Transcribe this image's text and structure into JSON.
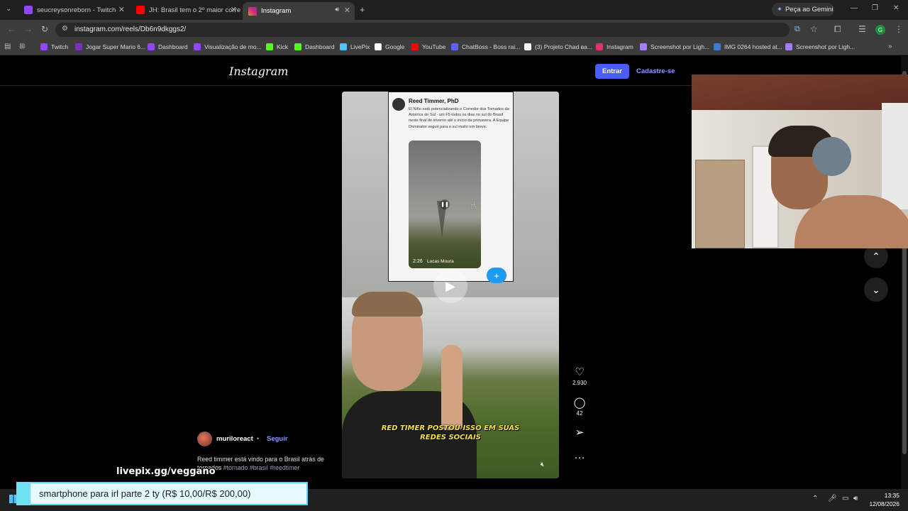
{
  "browser": {
    "tabs": [
      {
        "title": "seucreysonreborn - Twitch",
        "icon": "twitch-icon",
        "color": "#9146ff"
      },
      {
        "title": "JH: Brasil tem o 2º maior corre",
        "icon": "youtube-icon",
        "color": "#ff0000"
      },
      {
        "title": "Instagram",
        "icon": "instagram-icon",
        "color": "#e1306c",
        "active": true
      }
    ],
    "new_tab": "+",
    "gemini_label": "Peça ao Gemini",
    "url": "instagram.com/reels/Db6n9dkggs2/",
    "profile_initial": "G",
    "bookmarks": [
      {
        "label": "Twitch",
        "color": "#9146ff"
      },
      {
        "label": "Jogar Super Mario 6...",
        "color": "#7b2fbf"
      },
      {
        "label": "Dashboard",
        "color": "#9146ff"
      },
      {
        "label": "Visualização de mo...",
        "color": "#9146ff"
      },
      {
        "label": "Kick",
        "color": "#53fc18"
      },
      {
        "label": "Dashboard",
        "color": "#53fc18"
      },
      {
        "label": "LivePix",
        "color": "#4cc2ff"
      },
      {
        "label": "Google",
        "color": "#ffffff"
      },
      {
        "label": "YouTube",
        "color": "#ff0000"
      },
      {
        "label": "ChatBoss - Boss rai...",
        "color": "#5865f2"
      },
      {
        "label": "(3) Projeto Chad ва...",
        "color": "#ffffff"
      },
      {
        "label": "Instagram",
        "color": "#e1306c"
      },
      {
        "label": "Screenshot por Ligh...",
        "color": "#a77bff"
      },
      {
        "label": "IMG 0264 hosted at...",
        "color": "#3a7bd5"
      },
      {
        "label": "Screenshot por Ligh...",
        "color": "#a77bff"
      }
    ]
  },
  "instagram": {
    "logo": "Instagram",
    "login_button": "Entrar",
    "signup_link": "Cadastre-se",
    "reel": {
      "tweet_author": "Reed Timmer, PhD",
      "tweet_text": "El Niño está potencializando o Corredor dos Tornados da América do Sul - um F5 todos os dias no sul do Brasil neste final de inverno até o início da primavera. A Equipe Dominator seguir para o sul muito em breve.",
      "tweet_video_time": "2:26",
      "tweet_video_author": "Lucas Moura",
      "caption": "RED TIMER POSTOU ISSO EM SUAS REDES SOCIAIS"
    },
    "actions": {
      "likes": "2.930",
      "comments": "42"
    },
    "author": {
      "username": "muriloreact",
      "separator": "•",
      "follow": "Seguir"
    },
    "description": "Reed timmer está vindo para o Brasil atrás de tornados",
    "hashtags": "#tornado #brasil #reedtimer"
  },
  "overlays": {
    "livepix_handle": "livepix.gg/veggano",
    "alert_text": "smartphone para irl parte 2 ty (R$ 10,00/R$ 200,00)"
  },
  "taskbar": {
    "time": "13:35",
    "date": "12/08/2026"
  }
}
